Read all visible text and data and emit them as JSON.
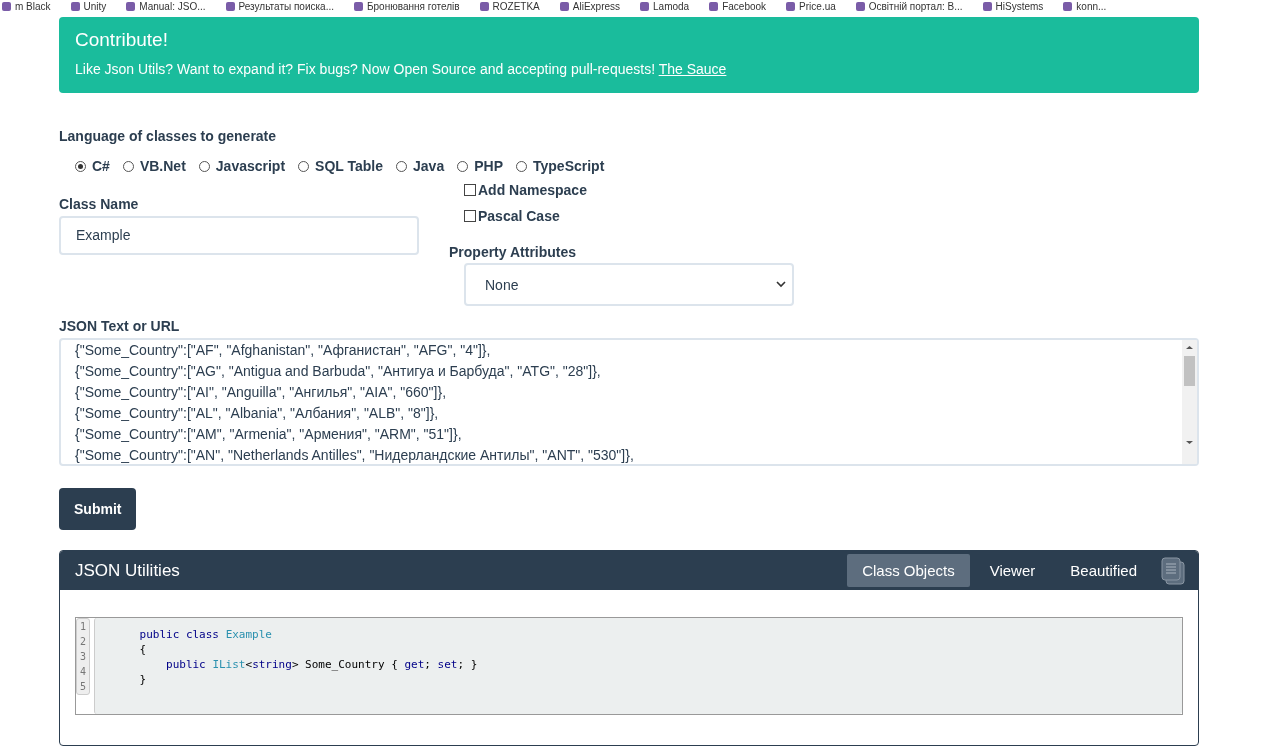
{
  "bookmarks": [
    {
      "label": "m Black"
    },
    {
      "label": "Unity"
    },
    {
      "label": "Manual: JSO..."
    },
    {
      "label": "Результаты поиска..."
    },
    {
      "label": "Бронювання готелів"
    },
    {
      "label": "ROZETKA"
    },
    {
      "label": "AliExpress"
    },
    {
      "label": "Lamoda"
    },
    {
      "label": "Facebook"
    },
    {
      "label": "Price.ua"
    },
    {
      "label": "Освітній портал: В..."
    },
    {
      "label": "HiSystems"
    },
    {
      "label": "konn..."
    }
  ],
  "banner": {
    "title": "Contribute!",
    "text": "Like Json Utils? Want to expand it? Fix bugs? Now Open Source and accepting pull-requests!",
    "link": "The Sauce"
  },
  "language": {
    "label": "Language of classes to generate",
    "options": [
      {
        "label": "C#",
        "selected": true
      },
      {
        "label": "VB.Net",
        "selected": false
      },
      {
        "label": "Javascript",
        "selected": false
      },
      {
        "label": "SQL Table",
        "selected": false
      },
      {
        "label": "Java",
        "selected": false
      },
      {
        "label": "PHP",
        "selected": false
      },
      {
        "label": "TypeScript",
        "selected": false
      }
    ]
  },
  "class_name": {
    "label": "Class Name",
    "value": "Example"
  },
  "options": [
    {
      "label": "Add Namespace",
      "checked": false
    },
    {
      "label": "Pascal Case",
      "checked": false
    }
  ],
  "property_attributes": {
    "label": "Property Attributes",
    "value": "None"
  },
  "json_text": {
    "label": "JSON Text or URL",
    "lines": [
      "{\"Some_Country\":[\"AF\", \"Afghanistan\", \"Афганистан\", \"AFG\", \"4\"]},",
      "{\"Some_Country\":[\"AG\", \"Antigua and Barbuda\", \"Антигуа и Барбуда\", \"ATG\", \"28\"]},",
      "{\"Some_Country\":[\"AI\", \"Anguilla\", \"Ангилья\", \"AIA\", \"660\"]},",
      "{\"Some_Country\":[\"AL\", \"Albania\", \"Албания\", \"ALB\", \"8\"]},",
      "{\"Some_Country\":[\"AM\", \"Armenia\", \"Армения\", \"ARM\", \"51\"]},",
      "{\"Some_Country\":[\"AN\", \"Netherlands Antilles\", \"Нидерландские Антилы\", \"ANT\", \"530\"]},"
    ]
  },
  "submit": "Submit",
  "panel": {
    "title": "JSON Utilities",
    "tabs": [
      {
        "label": "Class Objects",
        "selected": true
      },
      {
        "label": "Viewer",
        "selected": false
      },
      {
        "label": "Beautified",
        "selected": false
      }
    ],
    "line_numbers": [
      "1",
      "2",
      "3",
      "4",
      "5"
    ],
    "code": [
      [
        {
          "text": "    public class ",
          "kind": "keyword"
        },
        {
          "text": "Example",
          "kind": "type"
        }
      ],
      [
        {
          "text": "    {",
          "kind": "plain"
        }
      ],
      [
        {
          "text": "        public ",
          "kind": "keyword"
        },
        {
          "text": "IList",
          "kind": "type"
        },
        {
          "text": "<",
          "kind": "plain"
        },
        {
          "text": "string",
          "kind": "keyword"
        },
        {
          "text": "> Some_Country { ",
          "kind": "plain"
        },
        {
          "text": "get",
          "kind": "keyword"
        },
        {
          "text": "; ",
          "kind": "plain"
        },
        {
          "text": "set",
          "kind": "keyword"
        },
        {
          "text": "; }",
          "kind": "plain"
        }
      ],
      [
        {
          "text": "    }",
          "kind": "plain"
        }
      ]
    ]
  }
}
